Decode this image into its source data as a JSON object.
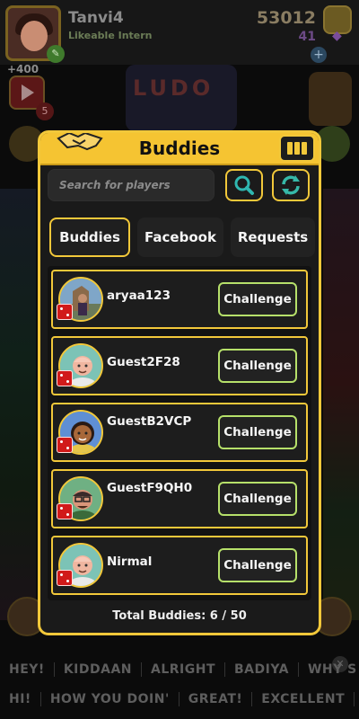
{
  "profile": {
    "name": "Tanvi4",
    "title": "Likeable Intern",
    "coins": "53012",
    "gems": "41",
    "bonus": "+400",
    "video_count": "5"
  },
  "logo": {
    "text": "LUDO"
  },
  "modal": {
    "title": "Buddies",
    "search_placeholder": "Search for players",
    "tabs": [
      "Buddies",
      "Facebook",
      "Requests"
    ],
    "active_tab": "Buddies",
    "buddies": [
      {
        "name": "aryaa123",
        "action": "Challenge"
      },
      {
        "name": "Guest2F28",
        "action": "Challenge"
      },
      {
        "name": "GuestB2VCP",
        "action": "Challenge"
      },
      {
        "name": "GuestF9QH0",
        "action": "Challenge"
      },
      {
        "name": "Nirmal",
        "action": "Challenge"
      }
    ],
    "total_label": "Total Buddies: 6 / 50"
  },
  "chat": {
    "row1": [
      "HEY!",
      "KIDDAAN",
      "ALRIGHT",
      "BADIYA",
      "WHY S"
    ],
    "row2": [
      "HI!",
      "HOW YOU DOIN'",
      "GREAT!",
      "EXCELLENT"
    ]
  },
  "colors": {
    "accent": "#f2c83a",
    "challenge_border": "#b6e06a",
    "panel": "#1a1a1a"
  }
}
